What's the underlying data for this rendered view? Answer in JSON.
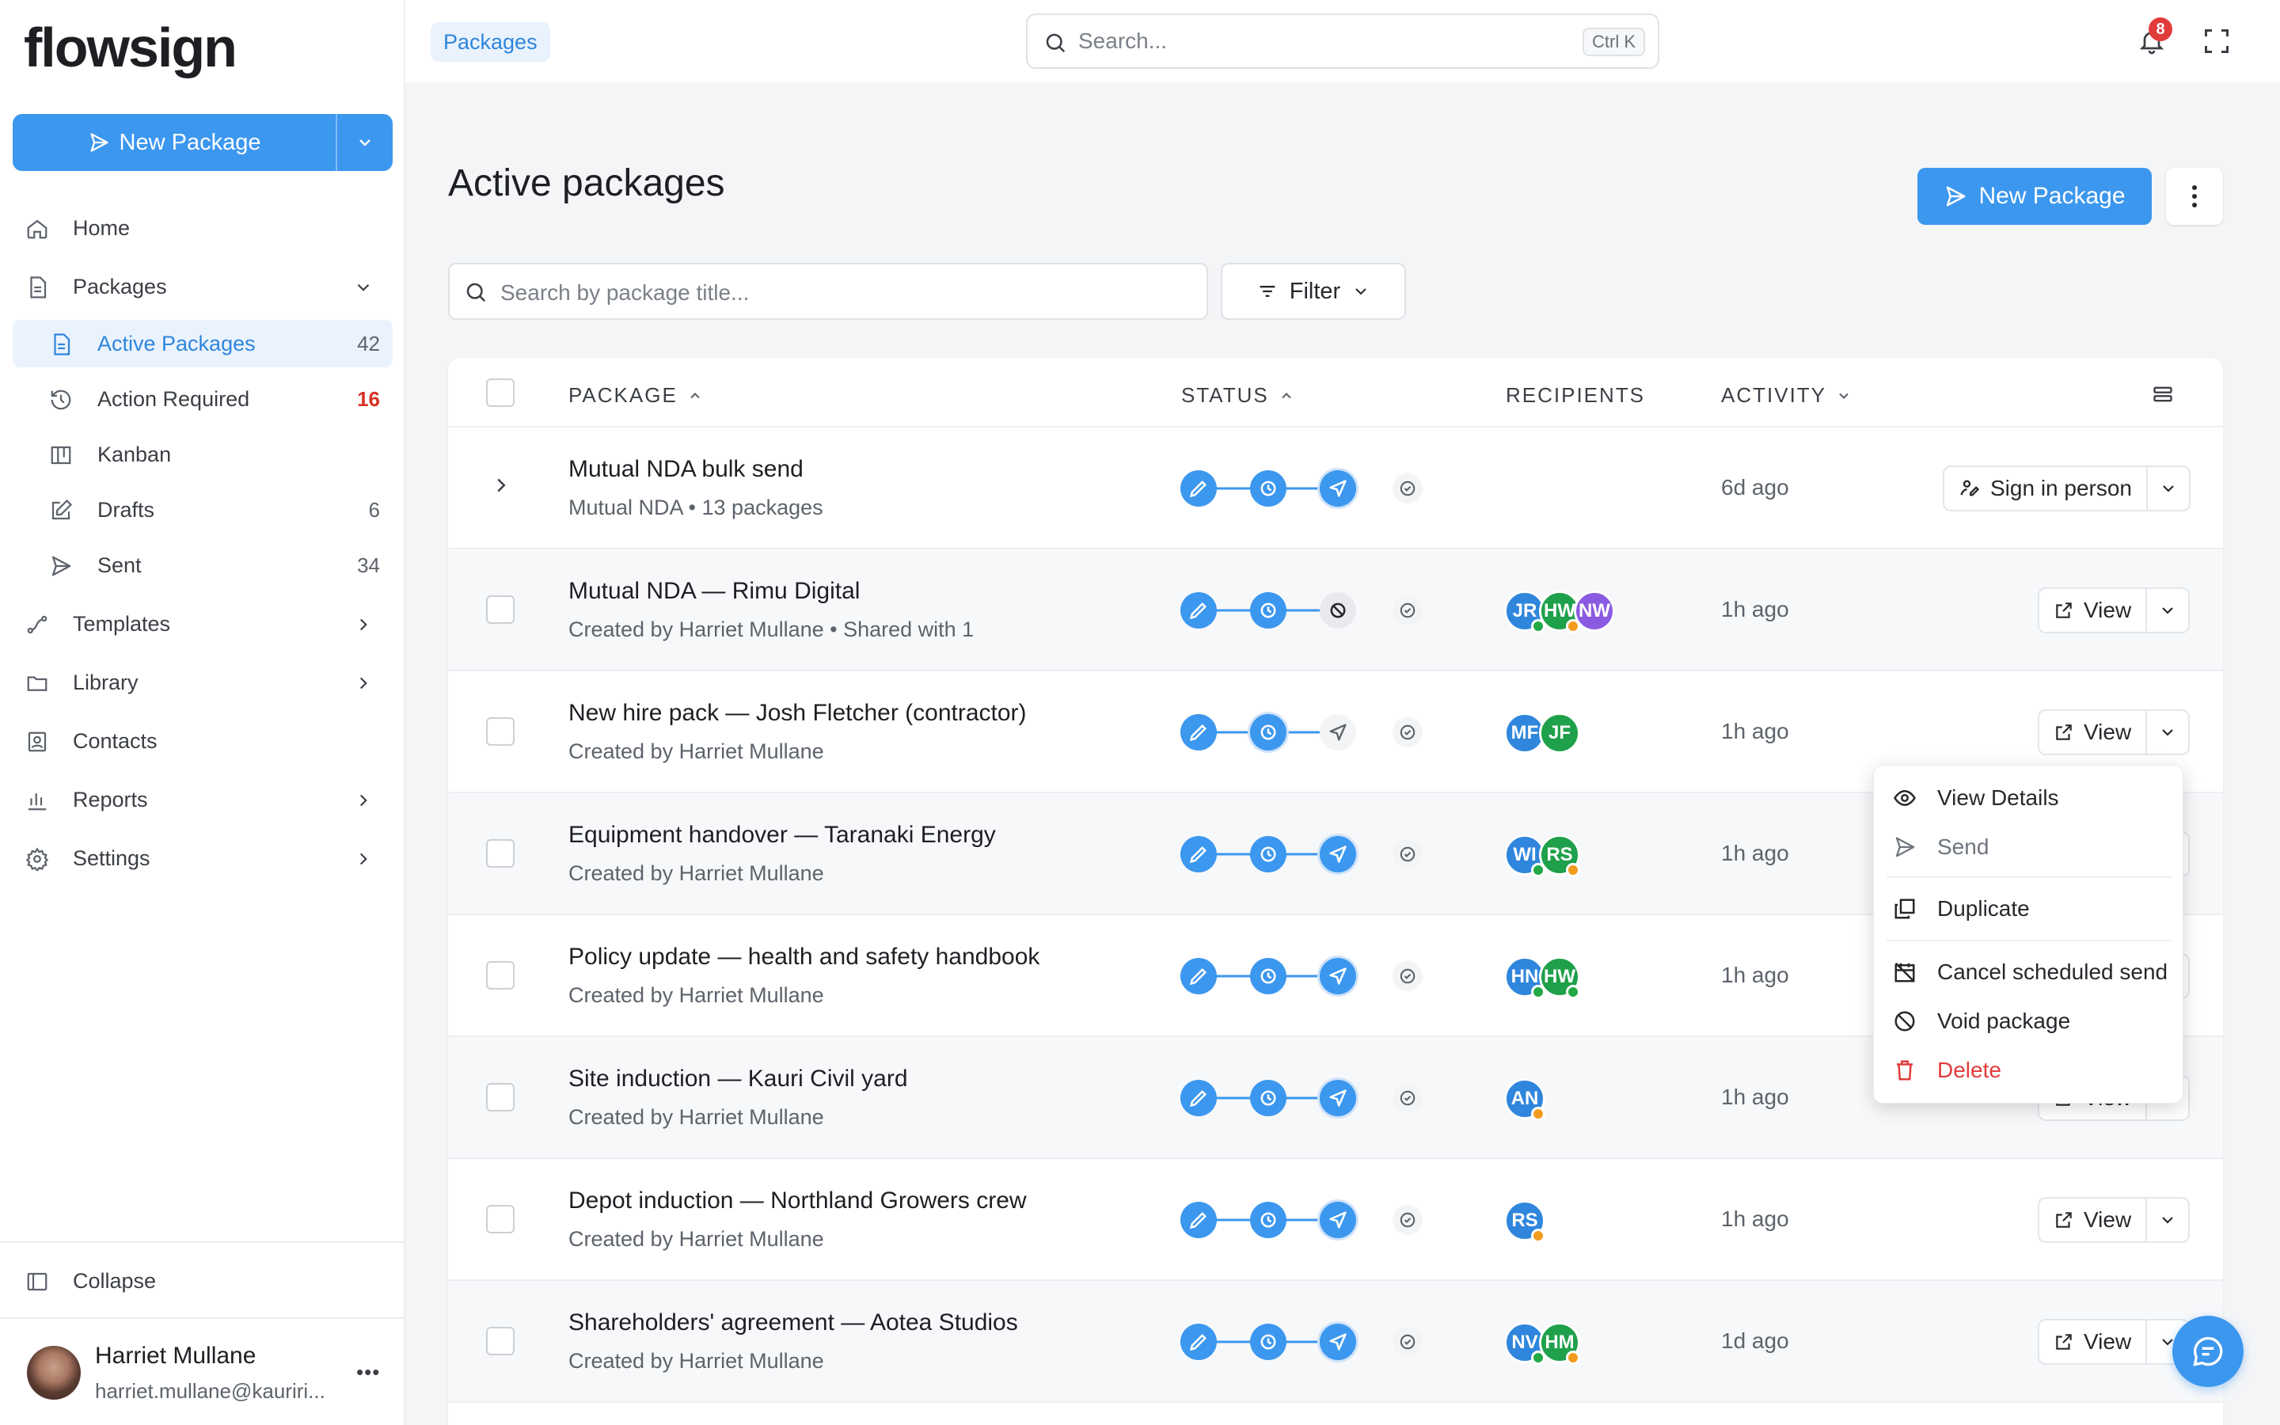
{
  "app": {
    "logo_text": "flowsign"
  },
  "sidebar": {
    "new_package_label": "New Package",
    "nav": {
      "home": "Home",
      "packages": "Packages",
      "active_packages": {
        "label": "Active Packages",
        "count": "42"
      },
      "action_required": {
        "label": "Action Required",
        "count": "16"
      },
      "kanban": "Kanban",
      "drafts": {
        "label": "Drafts",
        "count": "6"
      },
      "sent": {
        "label": "Sent",
        "count": "34"
      },
      "templates": "Templates",
      "library": "Library",
      "contacts": "Contacts",
      "reports": "Reports",
      "settings": "Settings"
    },
    "collapse_label": "Collapse",
    "user": {
      "name": "Harriet Mullane",
      "email": "harriet.mullane@kauriri..."
    }
  },
  "topbar": {
    "breadcrumb": "Packages",
    "search_placeholder": "Search...",
    "search_shortcut": "Ctrl K",
    "notification_count": "8"
  },
  "page": {
    "title": "Active packages",
    "new_package_label": "New Package",
    "search_placeholder": "Search by package title...",
    "filter_label": "Filter"
  },
  "table": {
    "columns": {
      "package": "PACKAGE",
      "status": "STATUS",
      "recipients": "RECIPIENTS",
      "activity": "ACTIVITY"
    },
    "rows": [
      {
        "title": "Mutual NDA bulk send",
        "subtitle": "Mutual NDA • 13 packages",
        "activity": "6d ago",
        "action": "Sign in person",
        "status": "sent",
        "recipients": []
      },
      {
        "title": "Mutual NDA — Rimu Digital",
        "subtitle": "Created by Harriet Mullane • Shared with 1",
        "activity": "1h ago",
        "action": "View",
        "status": "void",
        "recipients": [
          {
            "initials": "JR",
            "color": "#2f86dc",
            "dot": "#22a845"
          },
          {
            "initials": "HW",
            "color": "#1fa04a",
            "dot": "#f29b1d"
          },
          {
            "initials": "NW",
            "color": "#8a5be0",
            "dot": ""
          }
        ]
      },
      {
        "title": "New hire pack — Josh Fletcher (contractor)",
        "subtitle": "Created by Harriet Mullane",
        "activity": "1h ago",
        "action": "View",
        "status": "scheduled",
        "recipients": [
          {
            "initials": "MF",
            "color": "#2f86dc",
            "dot": ""
          },
          {
            "initials": "JF",
            "color": "#1fa04a",
            "dot": ""
          }
        ]
      },
      {
        "title": "Equipment handover — Taranaki Energy",
        "subtitle": "Created by Harriet Mullane",
        "activity": "1h ago",
        "action": "View",
        "status": "sent",
        "recipients": [
          {
            "initials": "WI",
            "color": "#2f86dc",
            "dot": "#22a845"
          },
          {
            "initials": "RS",
            "color": "#1fa04a",
            "dot": "#f29b1d"
          }
        ]
      },
      {
        "title": "Policy update — health and safety handbook",
        "subtitle": "Created by Harriet Mullane",
        "activity": "1h ago",
        "action": "View",
        "status": "sent",
        "recipients": [
          {
            "initials": "HN",
            "color": "#2f86dc",
            "dot": "#22a845"
          },
          {
            "initials": "HW",
            "color": "#1fa04a",
            "dot": "#22a845"
          }
        ]
      },
      {
        "title": "Site induction — Kauri Civil yard",
        "subtitle": "Created by Harriet Mullane",
        "activity": "1h ago",
        "action": "View",
        "status": "sent",
        "recipients": [
          {
            "initials": "AN",
            "color": "#2f86dc",
            "dot": "#f29b1d"
          }
        ]
      },
      {
        "title": "Depot induction — Northland Growers crew",
        "subtitle": "Created by Harriet Mullane",
        "activity": "1h ago",
        "action": "View",
        "status": "sent",
        "recipients": [
          {
            "initials": "RS",
            "color": "#2f86dc",
            "dot": "#f29b1d"
          }
        ]
      },
      {
        "title": "Shareholders' agreement — Aotea Studios",
        "subtitle": "Created by Harriet Mullane",
        "activity": "1d ago",
        "action": "View",
        "status": "sent",
        "recipients": [
          {
            "initials": "NV",
            "color": "#2f86dc",
            "dot": "#22a845"
          },
          {
            "initials": "HM",
            "color": "#1fa04a",
            "dot": "#f29b1d"
          }
        ]
      }
    ]
  },
  "row_menu": {
    "items": [
      "View Details",
      "Send",
      "Duplicate",
      "Cancel scheduled send",
      "Void package",
      "Delete"
    ]
  },
  "colors": {
    "accent": "#3c97ee",
    "danger": "#e23b3b",
    "success": "#22a845",
    "warning": "#f29b1d"
  }
}
